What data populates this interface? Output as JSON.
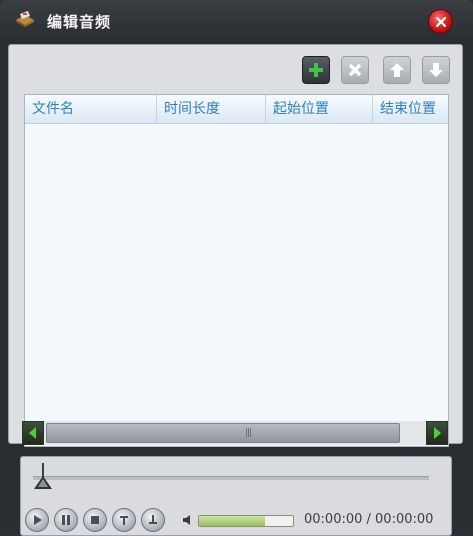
{
  "window": {
    "title": "编辑音频",
    "icon": "audio-edit-icon",
    "close_icon": "close-icon",
    "colors": {
      "titlebar": "#2c2f33",
      "close": "#d81a1a",
      "header_text": "#2f7fc1",
      "add_button": "#3aa04a"
    }
  },
  "toolbar": {
    "buttons": [
      {
        "name": "add",
        "icon": "plus-icon",
        "enabled": true
      },
      {
        "name": "delete",
        "icon": "x-icon",
        "enabled": false
      },
      {
        "name": "move-up",
        "icon": "arrow-up-icon",
        "enabled": false
      },
      {
        "name": "move-down",
        "icon": "arrow-down-icon",
        "enabled": false
      }
    ]
  },
  "table": {
    "columns": [
      "文件名",
      "时间长度",
      "起始位置",
      "结束位置"
    ],
    "rows": []
  },
  "player": {
    "time": "00:00:00 / 00:00:00",
    "volume": 0.7,
    "seek": 0.0
  }
}
